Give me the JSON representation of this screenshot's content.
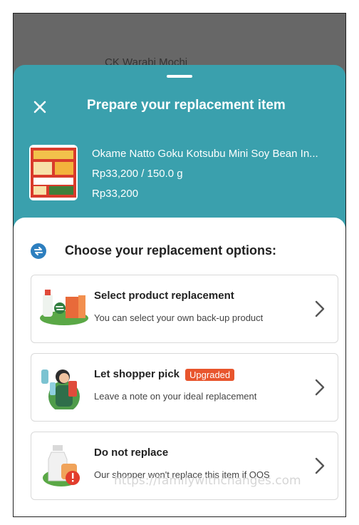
{
  "backdrop": {
    "title": "CK Warabi Mochi"
  },
  "header": {
    "close_icon": "close-icon",
    "title": "Prepare your replacement item"
  },
  "product": {
    "name": "Okame Natto Goku Kotsubu Mini Soy Bean In...",
    "unit_price": "Rp33,200 / 150.0 g",
    "price": "Rp33,200"
  },
  "section": {
    "title": "Choose your replacement options:",
    "icon": "swap-icon"
  },
  "options": [
    {
      "title": "Select product replacement",
      "subtitle": "You can select your own back-up product",
      "icon": "product-swap-illustration"
    },
    {
      "title": "Let shopper pick",
      "badge": "Upgraded",
      "subtitle": "Leave a note on your ideal replacement",
      "icon": "shopper-illustration"
    },
    {
      "title": "Do not replace",
      "subtitle": "Our shopper won't replace this item if OOS",
      "icon": "no-replace-illustration"
    }
  ],
  "watermark": "https://familywithchanges.com",
  "colors": {
    "header": "#3aa0ad",
    "badge": "#e8552d",
    "accent_icon": "#2d7fbf"
  }
}
